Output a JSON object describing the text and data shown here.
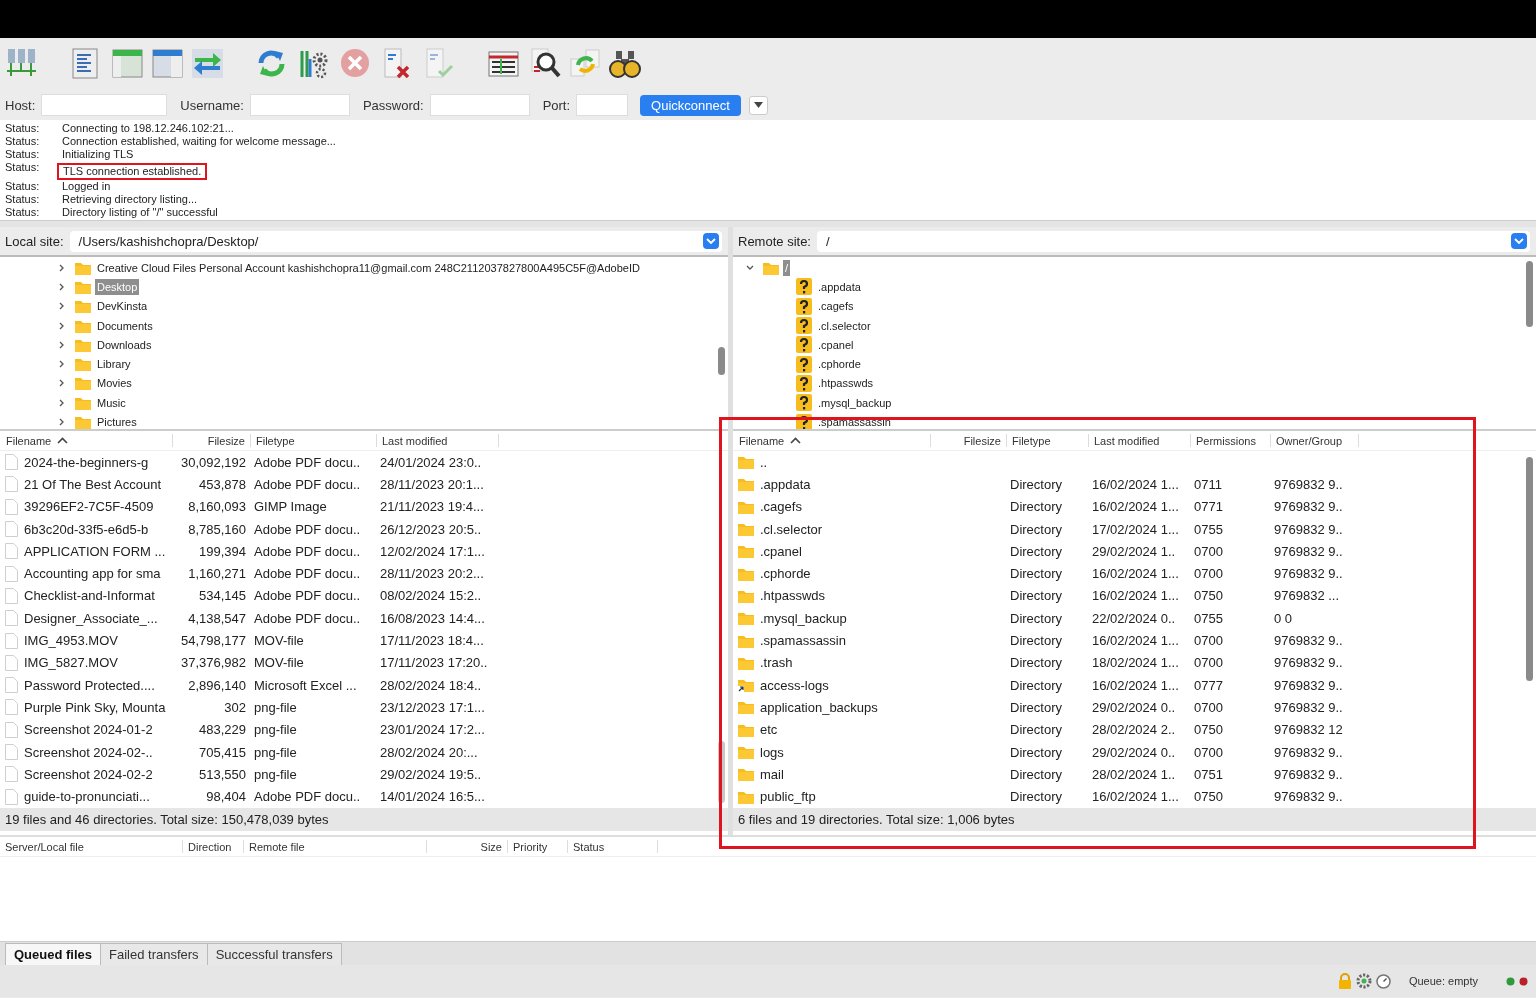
{
  "quickconnect": {
    "fields": [
      {
        "label": "Host:"
      },
      {
        "label": "Username:"
      },
      {
        "label": "Password:"
      },
      {
        "label": "Port:"
      }
    ],
    "button": "Quickconnect"
  },
  "message_log": [
    {
      "label": "Status:",
      "message": "Connecting to 198.12.246.102:21...",
      "highlighted": false
    },
    {
      "label": "Status:",
      "message": "Connection established, waiting for welcome message...",
      "highlighted": false
    },
    {
      "label": "Status:",
      "message": "Initializing TLS",
      "highlighted": false
    },
    {
      "label": "Status:",
      "message": "TLS connection established.",
      "highlighted": true
    },
    {
      "label": "Status:",
      "message": "Logged in",
      "highlighted": false
    },
    {
      "label": "Status:",
      "message": "Retrieving directory listing...",
      "highlighted": false
    },
    {
      "label": "Status:",
      "message": "Directory listing of \"/\" successful",
      "highlighted": false
    }
  ],
  "local": {
    "site_label": "Local site:",
    "path": "/Users/kashishchopra/Desktop/",
    "tree": [
      {
        "name": "Creative Cloud Files Personal Account kashishchopra11@gmail.com 248C2112037827800A495C5F@AdobeID",
        "kind": "folder",
        "expanded": false,
        "selected": false
      },
      {
        "name": "Desktop",
        "kind": "folder",
        "expanded": false,
        "selected": true
      },
      {
        "name": "DevKinsta",
        "kind": "folder",
        "expanded": false,
        "selected": false
      },
      {
        "name": "Documents",
        "kind": "folder",
        "expanded": false,
        "selected": false
      },
      {
        "name": "Downloads",
        "kind": "folder",
        "expanded": false,
        "selected": false
      },
      {
        "name": "Library",
        "kind": "folder",
        "expanded": false,
        "selected": false
      },
      {
        "name": "Movies",
        "kind": "folder",
        "expanded": false,
        "selected": false
      },
      {
        "name": "Music",
        "kind": "folder",
        "expanded": false,
        "selected": false
      },
      {
        "name": "Pictures",
        "kind": "folder",
        "expanded": false,
        "selected": false
      }
    ],
    "columns": [
      {
        "label": "Filename",
        "sorted": true
      },
      {
        "label": "Filesize",
        "sorted": false
      },
      {
        "label": "Filetype",
        "sorted": false
      },
      {
        "label": "Last modified",
        "sorted": false
      }
    ],
    "rows": [
      {
        "kind": "file",
        "cells": [
          "2024-the-beginners-g",
          "30,092,192",
          "Adobe PDF docu..",
          "24/01/2024 23:0.."
        ]
      },
      {
        "kind": "file",
        "cells": [
          "21 Of The Best Account",
          "453,878",
          "Adobe PDF docu..",
          "28/11/2023 20:1..."
        ]
      },
      {
        "kind": "file",
        "cells": [
          "39296EF2-7C5F-4509",
          "8,160,093",
          "GIMP Image",
          "21/11/2023 19:4..."
        ]
      },
      {
        "kind": "file",
        "cells": [
          "6b3c20d-33f5-e6d5-b",
          "8,785,160",
          "Adobe PDF docu..",
          "26/12/2023 20:5.."
        ]
      },
      {
        "kind": "file",
        "cells": [
          "APPLICATION FORM ...",
          "199,394",
          "Adobe PDF docu..",
          "12/02/2024 17:1..."
        ]
      },
      {
        "kind": "file",
        "cells": [
          "Accounting app for sma",
          "1,160,271",
          "Adobe PDF docu..",
          "28/11/2023 20:2..."
        ]
      },
      {
        "kind": "file",
        "cells": [
          "Checklist-and-Informat",
          "534,145",
          "Adobe PDF docu..",
          "08/02/2024 15:2.."
        ]
      },
      {
        "kind": "file",
        "cells": [
          "Designer_Associate_...",
          "4,138,547",
          "Adobe PDF docu..",
          "16/08/2023 14:4..."
        ]
      },
      {
        "kind": "file",
        "cells": [
          "IMG_4953.MOV",
          "54,798,177",
          "MOV-file",
          "17/11/2023 18:4..."
        ]
      },
      {
        "kind": "file",
        "cells": [
          "IMG_5827.MOV",
          "37,376,982",
          "MOV-file",
          "17/11/2023 17:20.."
        ]
      },
      {
        "kind": "file",
        "cells": [
          "Password Protected....",
          "2,896,140",
          "Microsoft Excel ...",
          "28/02/2024 18:4.."
        ]
      },
      {
        "kind": "file",
        "cells": [
          "Purple Pink Sky, Mounta",
          "302",
          "png-file",
          "23/12/2023 17:1..."
        ]
      },
      {
        "kind": "file",
        "cells": [
          "Screenshot 2024-01-2",
          "483,229",
          "png-file",
          "23/01/2024 17:2..."
        ]
      },
      {
        "kind": "file",
        "cells": [
          "Screenshot 2024-02-..",
          "705,415",
          "png-file",
          "28/02/2024 20:..."
        ]
      },
      {
        "kind": "file",
        "cells": [
          "Screenshot 2024-02-2",
          "513,550",
          "png-file",
          "29/02/2024 19:5.."
        ]
      },
      {
        "kind": "file",
        "cells": [
          "guide-to-pronunciati...",
          "98,404",
          "Adobe PDF docu..",
          "14/01/2024 16:5..."
        ]
      }
    ],
    "summary": "19 files and 46 directories. Total size: 150,478,039 bytes"
  },
  "remote": {
    "site_label": "Remote site:",
    "path": "/",
    "highlighted": true,
    "tree": [
      {
        "name": "/",
        "kind": "folder",
        "expanded": true,
        "selected": true,
        "children": [
          {
            "name": ".appdata",
            "kind": "unknown"
          },
          {
            "name": ".cagefs",
            "kind": "unknown"
          },
          {
            "name": ".cl.selector",
            "kind": "unknown"
          },
          {
            "name": ".cpanel",
            "kind": "unknown"
          },
          {
            "name": ".cphorde",
            "kind": "unknown"
          },
          {
            "name": ".htpasswds",
            "kind": "unknown"
          },
          {
            "name": ".mysql_backup",
            "kind": "unknown"
          },
          {
            "name": ".spamassassin",
            "kind": "unknown"
          }
        ]
      }
    ],
    "columns": [
      {
        "label": "Filename",
        "sorted": true
      },
      {
        "label": "Filesize",
        "sorted": false
      },
      {
        "label": "Filetype",
        "sorted": false
      },
      {
        "label": "Last modified",
        "sorted": false
      },
      {
        "label": "Permissions",
        "sorted": false
      },
      {
        "label": "Owner/Group",
        "sorted": false
      }
    ],
    "rows": [
      {
        "kind": "folder",
        "cells": [
          ".."
        ]
      },
      {
        "kind": "folder",
        "cells": [
          ".appdata",
          "",
          "Directory",
          "16/02/2024 1...",
          "0711",
          "9769832 9.."
        ]
      },
      {
        "kind": "folder",
        "cells": [
          ".cagefs",
          "",
          "Directory",
          "16/02/2024 1...",
          "0771",
          "9769832 9.."
        ]
      },
      {
        "kind": "folder",
        "cells": [
          ".cl.selector",
          "",
          "Directory",
          "17/02/2024 1...",
          "0755",
          "9769832 9.."
        ]
      },
      {
        "kind": "folder",
        "cells": [
          ".cpanel",
          "",
          "Directory",
          "29/02/2024 1..",
          "0700",
          "9769832 9.."
        ]
      },
      {
        "kind": "folder",
        "cells": [
          ".cphorde",
          "",
          "Directory",
          "16/02/2024 1...",
          "0700",
          "9769832 9.."
        ]
      },
      {
        "kind": "folder",
        "cells": [
          ".htpasswds",
          "",
          "Directory",
          "16/02/2024 1...",
          "0750",
          "9769832 ..."
        ]
      },
      {
        "kind": "folder",
        "cells": [
          ".mysql_backup",
          "",
          "Directory",
          "22/02/2024 0..",
          "0755",
          "0 0"
        ]
      },
      {
        "kind": "folder",
        "cells": [
          ".spamassassin",
          "",
          "Directory",
          "16/02/2024 1...",
          "0700",
          "9769832 9.."
        ]
      },
      {
        "kind": "folder",
        "cells": [
          ".trash",
          "",
          "Directory",
          "18/02/2024 1...",
          "0700",
          "9769832 9.."
        ]
      },
      {
        "kind": "link",
        "cells": [
          "access-logs",
          "",
          "Directory",
          "16/02/2024 1...",
          "0777",
          "9769832 9.."
        ]
      },
      {
        "kind": "folder",
        "cells": [
          "application_backups",
          "",
          "Directory",
          "29/02/2024 0..",
          "0700",
          "9769832 9.."
        ]
      },
      {
        "kind": "folder",
        "cells": [
          "etc",
          "",
          "Directory",
          "28/02/2024 2..",
          "0750",
          "9769832 12"
        ]
      },
      {
        "kind": "folder",
        "cells": [
          "logs",
          "",
          "Directory",
          "29/02/2024 0..",
          "0700",
          "9769832 9.."
        ]
      },
      {
        "kind": "folder",
        "cells": [
          "mail",
          "",
          "Directory",
          "28/02/2024 1..",
          "0751",
          "9769832 9.."
        ]
      },
      {
        "kind": "folder",
        "cells": [
          "public_ftp",
          "",
          "Directory",
          "16/02/2024 1...",
          "0750",
          "9769832 9.."
        ]
      }
    ],
    "summary": "6 files and 19 directories. Total size: 1,006 bytes"
  },
  "queue": {
    "columns": [
      {
        "label": "Server/Local file"
      },
      {
        "label": "Direction"
      },
      {
        "label": "Remote file"
      },
      {
        "label": "Size"
      },
      {
        "label": "Priority"
      },
      {
        "label": "Status"
      }
    ]
  },
  "queue_tabs": [
    {
      "label": "Queued files",
      "selected": true
    },
    {
      "label": "Failed transfers",
      "selected": false
    },
    {
      "label": "Successful transfers",
      "selected": false
    }
  ],
  "status_bar": {
    "queue": "Queue: empty"
  }
}
